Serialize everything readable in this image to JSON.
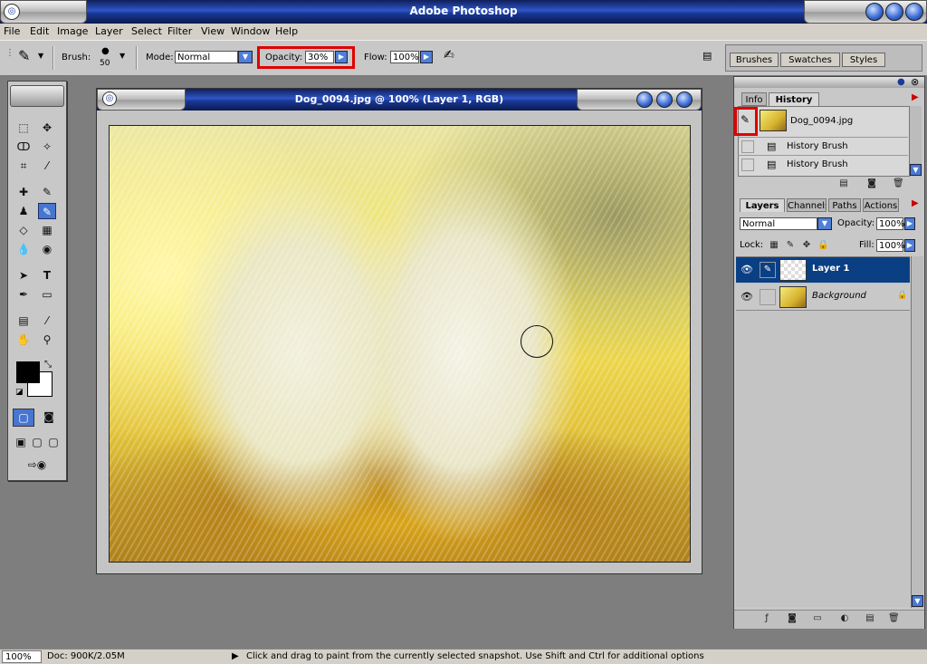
{
  "window": {
    "title": "Adobe Photoshop"
  },
  "menu": [
    "File",
    "Edit",
    "Image",
    "Layer",
    "Select",
    "Filter",
    "View",
    "Window",
    "Help"
  ],
  "options": {
    "brush_label": "Brush:",
    "brush_size": "50",
    "mode_label": "Mode:",
    "mode_value": "Normal",
    "opacity_label": "Opacity:",
    "opacity_value": "30%",
    "flow_label": "Flow:",
    "flow_value": "100%"
  },
  "well_tabs": [
    "Brushes",
    "Swatches",
    "Styles"
  ],
  "document": {
    "title": "Dog_0094.jpg @ 100% (Layer 1, RGB)"
  },
  "history": {
    "tabs": [
      "Info",
      "History"
    ],
    "snapshot_name": "Dog_0094.jpg",
    "states": [
      "History Brush",
      "History Brush"
    ]
  },
  "layers": {
    "tabs": [
      "Layers",
      "Channels",
      "Paths",
      "Actions"
    ],
    "blend_mode": "Normal",
    "opacity_label": "Opacity:",
    "opacity_value": "100%",
    "lock_label": "Lock:",
    "fill_label": "Fill:",
    "fill_value": "100%",
    "items": [
      {
        "name": "Layer 1",
        "selected": true
      },
      {
        "name": "Background",
        "selected": false
      }
    ]
  },
  "status": {
    "zoom": "100%",
    "doc_info": "Doc: 900K/2.05M",
    "hint": "Click and drag to paint from the currently selected snapshot.  Use Shift and Ctrl for additional options"
  },
  "colors": {
    "title_blue": "#2f55c8",
    "selection_blue": "#0a3f84",
    "highlight_red": "#e00000",
    "foreground": "#000000",
    "background": "#ffffff"
  }
}
